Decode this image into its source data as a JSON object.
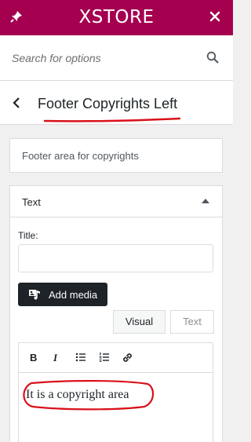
{
  "header": {
    "logo": "XSTORE",
    "pin_icon": "pin-icon",
    "close_icon": "close-icon",
    "background": "#a4004f"
  },
  "search": {
    "placeholder": "Search for options",
    "value": "",
    "icon": "search-icon"
  },
  "section": {
    "title": "Footer Copyrights Left",
    "back_icon": "chevron-left-icon",
    "description": "Footer area for copyrights"
  },
  "widget": {
    "title": "Text",
    "toggle_icon": "arrow-up-icon",
    "title_label": "Title:",
    "title_value": "",
    "add_media_label": "Add media",
    "tabs": {
      "visual": "Visual",
      "text": "Text"
    },
    "toolbar": {
      "bold": "B",
      "italic": "I",
      "bullet_list_icon": "bullet-list-icon",
      "numbered_list_icon": "numbered-list-icon",
      "link_icon": "link-icon"
    },
    "content": "It is a copyright area"
  },
  "annotations": {
    "color": "#d9111a"
  }
}
